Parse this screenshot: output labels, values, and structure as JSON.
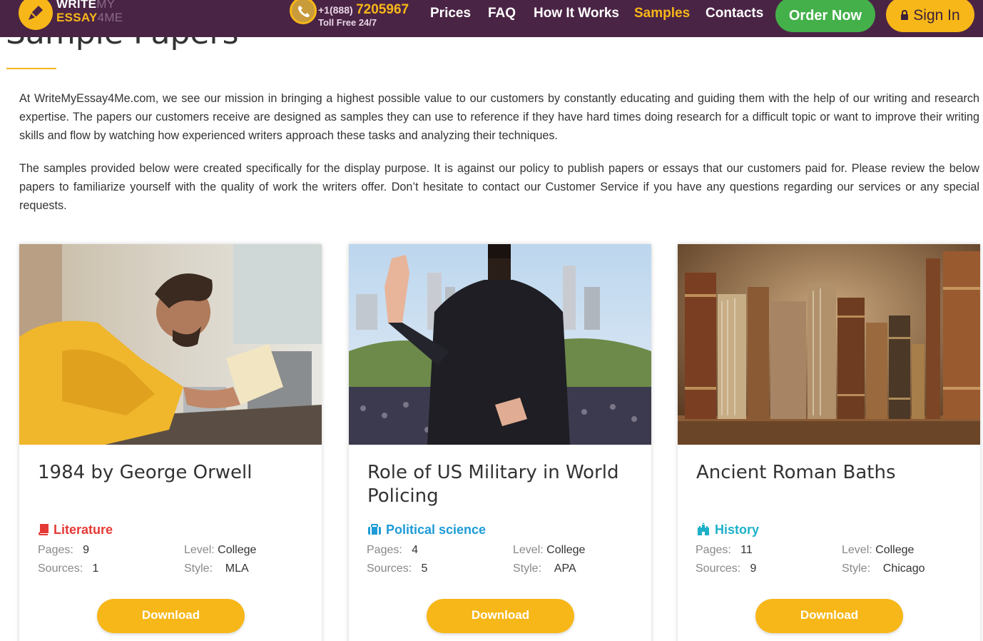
{
  "header": {
    "logo": {
      "write": "WRITE",
      "my": "MY",
      "essay": "ESSAY",
      "four_me": "4ME"
    },
    "phone": {
      "prefix": "+1(888)",
      "number": "7205967",
      "toll": "Toll Free 24/7"
    },
    "nav": [
      {
        "label": "Prices"
      },
      {
        "label": "FAQ"
      },
      {
        "label": "How It Works"
      },
      {
        "label": "Samples",
        "active": true
      },
      {
        "label": "Contacts"
      }
    ],
    "order_label": "Order Now",
    "signin_label": "Sign In"
  },
  "page": {
    "title": "Sample Papers",
    "intro_1": "At WriteMyEssay4Me.com, we see our mission in bringing a highest possible value to our customers by constantly educating and guiding them with the help of our writing and research expertise. The papers our customers receive are designed as samples they can use to reference if they have hard times doing research for a difficult topic or want to improve their writing skills and flow by watching how experienced writers approach these tasks and analyzing their techniques.",
    "intro_2": "The samples provided below were created specifically for the display purpose. It is against our policy to publish papers or essays that our customers paid for. Please review the below papers to familiarize yourself with the quality of work the writers offer. Don’t hesitate to contact our Customer Service if you have any questions regarding our services or any special requests."
  },
  "labels": {
    "pages": "Pages:",
    "sources": "Sources:",
    "level": "Level:",
    "style": "Style:",
    "download": "Download"
  },
  "cards": [
    {
      "title": "1984 by George Orwell",
      "subject": "Literature",
      "subject_color": "#e53935",
      "icon": "book-icon",
      "pages": "9",
      "sources": "1",
      "level": "College",
      "style": "MLA"
    },
    {
      "title": "Role of US Military in World Policing",
      "subject": "Political science",
      "subject_color": "#1e9bd7",
      "icon": "briefcase-icon",
      "pages": "4",
      "sources": "5",
      "level": "College",
      "style": "APA"
    },
    {
      "title": "Ancient Roman Baths",
      "subject": "History",
      "subject_color": "#1eb0c8",
      "icon": "castle-icon",
      "pages": "11",
      "sources": "9",
      "level": "College",
      "style": "Chicago"
    }
  ],
  "colors": {
    "header_bg": "#4a2445",
    "accent": "#f7b719",
    "order_green": "#43b04a"
  }
}
